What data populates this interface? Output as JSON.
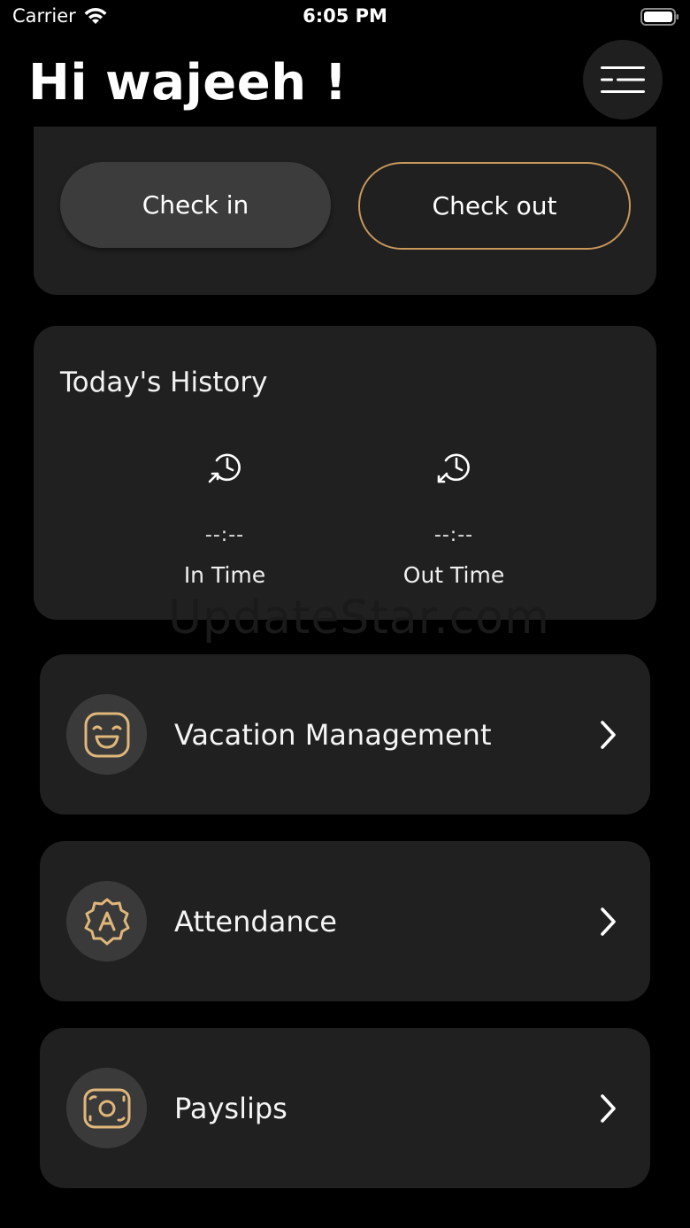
{
  "status_bar": {
    "carrier": "Carrier",
    "time": "6:05 PM"
  },
  "header": {
    "greeting": "Hi wajeeh !",
    "menu_icon": "hamburger-menu-icon"
  },
  "check": {
    "check_in_label": "Check in",
    "check_out_label": "Check out"
  },
  "history": {
    "title": "Today's History",
    "in_value": "--:--",
    "in_label": "In Time",
    "out_value": "--:--",
    "out_label": "Out Time"
  },
  "watermark": "UpdateStar.com",
  "menu_items": [
    {
      "label": "Vacation Management",
      "icon": "smile-face-icon"
    },
    {
      "label": "Attendance",
      "icon": "badge-a-icon"
    },
    {
      "label": "Payslips",
      "icon": "money-bill-icon"
    }
  ],
  "colors": {
    "background": "#000000",
    "card": "#202020",
    "accent": "#c8975a",
    "icon_gold": "#e0b77a"
  }
}
